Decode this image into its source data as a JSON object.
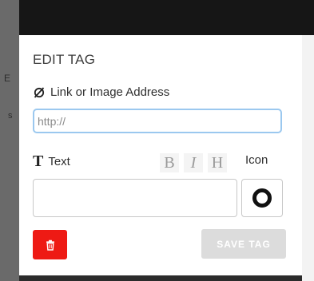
{
  "background_fragments": {
    "left_frag_1": "E",
    "left_frag_2": "s"
  },
  "dialog": {
    "title": "EDIT TAG",
    "link_label": "Link or Image Address",
    "link_placeholder": "http://",
    "link_value": "",
    "text_label": "Text",
    "format_buttons": {
      "bold": "B",
      "italic": "I",
      "heading": "H"
    },
    "icon_label": "Icon",
    "text_value": "",
    "selected_icon": "ring-icon",
    "delete_icon": "trash-icon",
    "save_label": "SAVE TAG"
  },
  "colors": {
    "delete_button": "#ee1a14",
    "save_button_disabled": "#dcdcdc",
    "input_focus_border": "#9bc8ef"
  }
}
